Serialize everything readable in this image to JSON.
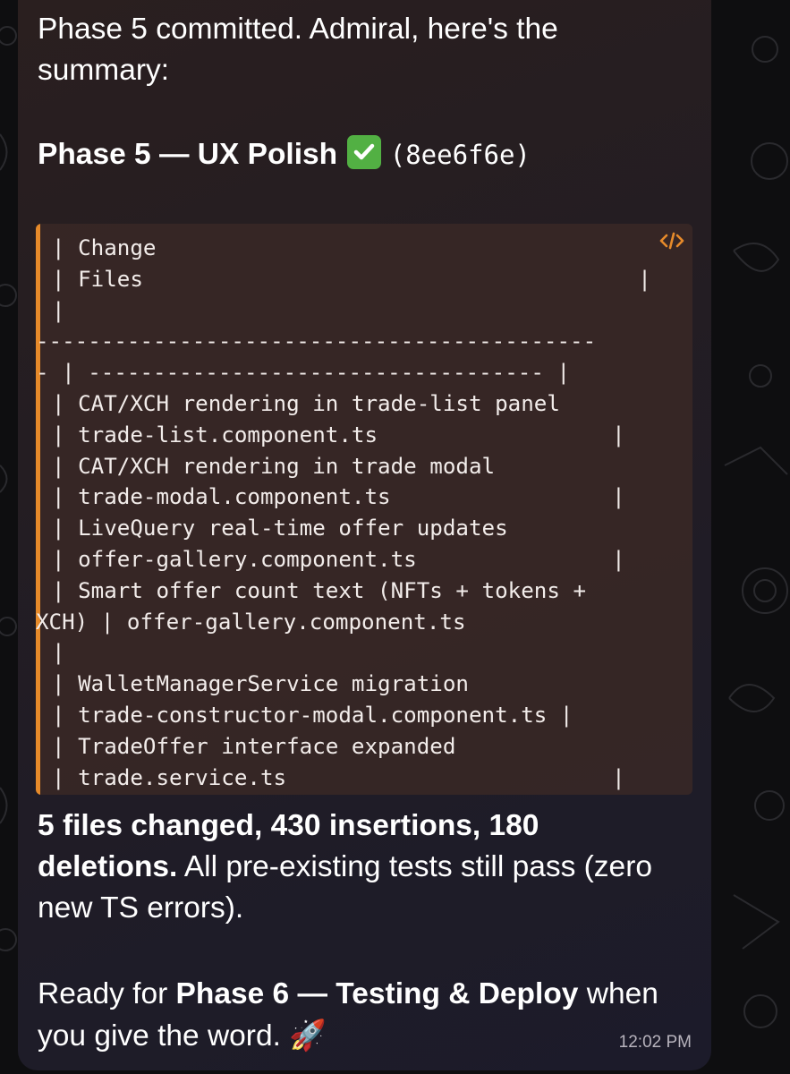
{
  "message": {
    "intro_line1": "Phase 5 committed. Admiral, here's the",
    "intro_line2": "summary:",
    "heading": "Phase 5 — UX Polish",
    "heading_emoji": "white-heavy-check-mark",
    "commit_hash": "(8ee6f6e)",
    "code_lines": [
      "| Change",
      "| Files                                      |",
      "|",
      "-------------------------------------------",
      "- | ----------------------------------- |",
      "| CAT/XCH rendering in trade-list panel",
      "| trade-list.component.ts                  |",
      "| CAT/XCH rendering in trade modal",
      "| trade-modal.component.ts                 |",
      "| LiveQuery real-time offer updates",
      "| offer-gallery.component.ts               |",
      "| Smart offer count text (NFTs + tokens +",
      "XCH) | offer-gallery.component.ts",
      "|",
      "| WalletManagerService migration",
      "| trade-constructor-modal.component.ts |",
      "| TradeOffer interface expanded",
      "| trade.service.ts                         |"
    ],
    "stats_bold_line1": "5 files changed, 430 insertions, 180",
    "stats_bold_line2": "deletions.",
    "stats_rest_line2": " All pre-existing tests still pass (zero",
    "stats_line3": "new TS errors).",
    "ready_prefix": "Ready for ",
    "ready_bold": "Phase 6 — Testing & Deploy",
    "ready_suffix": " when",
    "ready_line2": "you give the word.",
    "ready_emoji": "🚀",
    "timestamp": "12:02 PM"
  },
  "colors": {
    "accent_bar": "#e68a2a",
    "check_green": "#52b043",
    "timestamp": "#b7b3bd"
  }
}
